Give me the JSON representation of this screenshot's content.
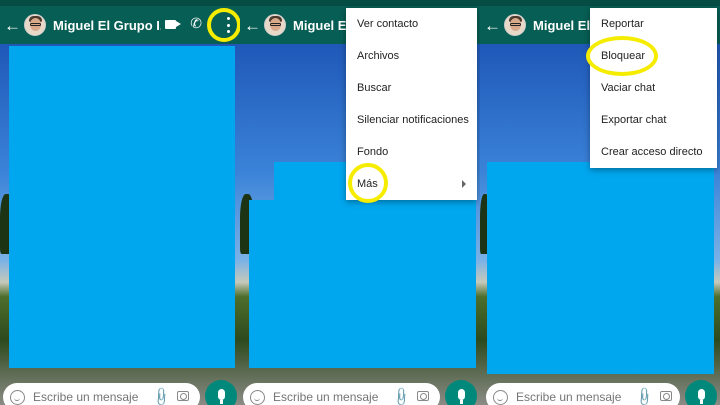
{
  "composer": {
    "placeholder": "Escribe un mensaje"
  },
  "panels": [
    {
      "header": {
        "contact_name": "Miguel El Grupo I..."
      },
      "icons": {
        "back": "arrow-back-icon",
        "video": "videocam-icon",
        "call": "phone-icon",
        "menu": "more-vert-icon"
      }
    },
    {
      "header": {
        "contact_name": "Miguel El Gru"
      },
      "menu": {
        "items": [
          "Ver contacto",
          "Archivos",
          "Buscar",
          "Silenciar notificaciones",
          "Fondo",
          "Más"
        ]
      }
    },
    {
      "header": {
        "contact_name": "Miguel El Gru"
      },
      "menu": {
        "items": [
          "Reportar",
          "Bloquear",
          "Vaciar chat",
          "Exportar chat",
          "Crear acceso directo"
        ]
      }
    }
  ],
  "colors": {
    "appbar": "#075e54",
    "highlight": "#f5ec00",
    "redaction": "#00a6ee",
    "mic": "#00897b"
  }
}
